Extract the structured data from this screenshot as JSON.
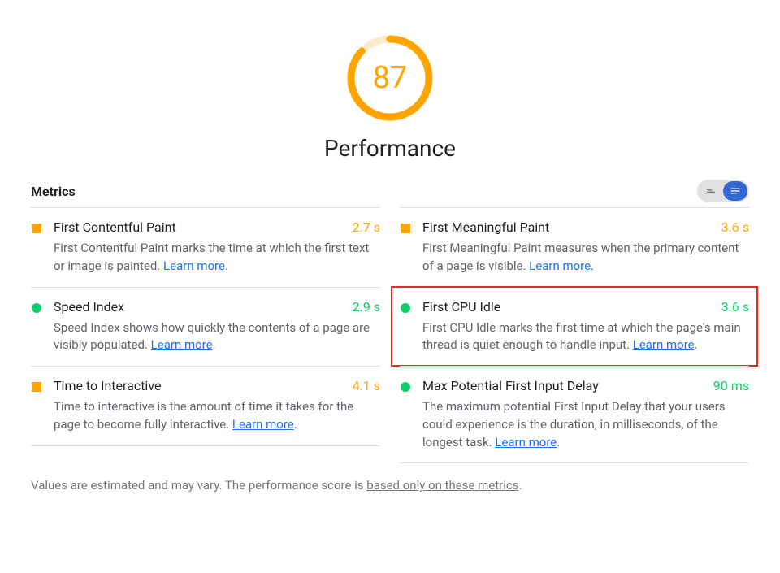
{
  "gauge": {
    "score": "87",
    "label": "Performance",
    "color": "#ffa400",
    "percent": 87
  },
  "metrics_title": "Metrics",
  "columns": {
    "left": [
      {
        "indicator": "square",
        "title": "First Contentful Paint",
        "value": "2.7 s",
        "value_color": "orange",
        "desc_before": "First Contentful Paint marks the time at which the first text or image is painted. ",
        "learn": "Learn more",
        "desc_after": ".",
        "highlighted": false
      },
      {
        "indicator": "circle",
        "title": "Speed Index",
        "value": "2.9 s",
        "value_color": "green",
        "desc_before": "Speed Index shows how quickly the contents of a page are visibly populated. ",
        "learn": "Learn more",
        "desc_after": ".",
        "highlighted": false
      },
      {
        "indicator": "square",
        "title": "Time to Interactive",
        "value": "4.1 s",
        "value_color": "orange",
        "desc_before": "Time to interactive is the amount of time it takes for the page to become fully interactive. ",
        "learn": "Learn more",
        "desc_after": ".",
        "highlighted": false
      }
    ],
    "right": [
      {
        "indicator": "square",
        "title": "First Meaningful Paint",
        "value": "3.6 s",
        "value_color": "orange",
        "desc_before": "First Meaningful Paint measures when the primary content of a page is visible. ",
        "learn": "Learn more",
        "desc_after": ".",
        "highlighted": false
      },
      {
        "indicator": "circle",
        "title": "First CPU Idle",
        "value": "3.6 s",
        "value_color": "green",
        "desc_before": "First CPU Idle marks the first time at which the page's main thread is quiet enough to handle input. ",
        "learn": "Learn more",
        "desc_after": ".",
        "highlighted": true
      },
      {
        "indicator": "circle",
        "title": "Max Potential First Input Delay",
        "value": "90 ms",
        "value_color": "green",
        "desc_before": "The maximum potential First Input Delay that your users could experience is the duration, in milliseconds, of the longest task. ",
        "learn": "Learn more",
        "desc_after": ".",
        "highlighted": false
      }
    ]
  },
  "footnote": {
    "text_before": "Values are estimated and may vary. The performance score is ",
    "link": "based only on these metrics",
    "text_after": "."
  }
}
